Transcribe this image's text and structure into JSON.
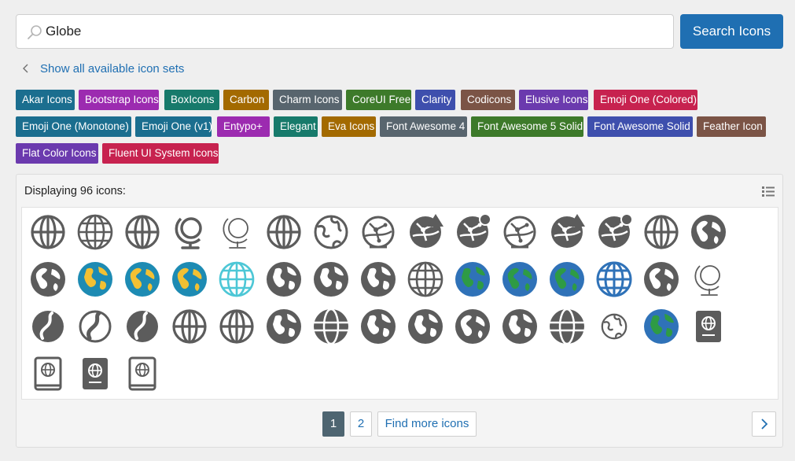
{
  "search": {
    "value": "Globe",
    "button_label": "Search Icons"
  },
  "back_link": {
    "label": "Show all available icon sets"
  },
  "tags": [
    {
      "label": "Akar Icons",
      "color": "#1b6e8f"
    },
    {
      "label": "Bootstrap Icons",
      "color": "#9c2bb0"
    },
    {
      "label": "BoxIcons",
      "color": "#177a6b"
    },
    {
      "label": "Carbon",
      "color": "#a36a00"
    },
    {
      "label": "Charm Icons",
      "color": "#58656e"
    },
    {
      "label": "CoreUI Free",
      "color": "#3d7a2a"
    },
    {
      "label": "Clarity",
      "color": "#3e4fad"
    },
    {
      "label": "Codicons",
      "color": "#7b5446"
    },
    {
      "label": "Elusive Icons",
      "color": "#6b3aae"
    },
    {
      "label": "Emoji One (Colored)",
      "color": "#c7224f"
    },
    {
      "label": "Emoji One (Monotone)",
      "color": "#1b6e8f"
    },
    {
      "label": "Emoji One (v1)",
      "color": "#1b6e8f"
    },
    {
      "label": "Entypo+",
      "color": "#9c2bb0"
    },
    {
      "label": "Elegant",
      "color": "#177a6b"
    },
    {
      "label": "Eva Icons",
      "color": "#a36a00"
    },
    {
      "label": "Font Awesome 4",
      "color": "#58656e"
    },
    {
      "label": "Font Awesome 5 Solid",
      "color": "#3d7a2a"
    },
    {
      "label": "Font Awesome Solid",
      "color": "#3e4fad"
    },
    {
      "label": "Feather Icon",
      "color": "#7b5446"
    },
    {
      "label": "Flat Color Icons",
      "color": "#6b3aae"
    },
    {
      "label": "Fluent UI System Icons",
      "color": "#c7224f"
    }
  ],
  "results": {
    "title": "Displaying 96 icons:"
  },
  "icons": [
    "globe-icon",
    "globe-grid-icon",
    "globe-icon",
    "desk-globe-icon",
    "desk-globe-outline-icon",
    "globe-icon",
    "earth-outline-icon",
    "globe-network-icon",
    "globe-network-warning-icon",
    "globe-network-dot-icon",
    "globe-network-icon",
    "globe-network-warning-icon",
    "globe-network-dot-icon",
    "globe-icon",
    "earth-africa-icon",
    "earth-africa-icon",
    "earth-americas-color-icon",
    "earth-asia-color-icon",
    "earth-africa-color-icon",
    "globe-cyan-icon",
    "earth-americas-icon",
    "earth-americas-icon",
    "earth-americas-icon",
    "globe-grid-icon",
    "earth-americas-blue-icon",
    "earth-asia-blue-icon",
    "earth-africa-blue-icon",
    "globe-meridian-blue-icon",
    "earth-africa-icon",
    "desk-globe-outline-icon",
    "earth-minimal-icon",
    "earth-outline-icon",
    "earth-minimal-icon",
    "globe-icon",
    "globe-icon",
    "earth-americas-icon",
    "globe-solid-icon",
    "earth-americas-icon",
    "earth-americas-icon",
    "earth-asia-icon",
    "earth-europe-icon",
    "globe-solid-icon",
    "earth-small-icon",
    "earth-color-icon",
    "passport-icon",
    "passport-outline-icon",
    "passport-icon",
    "passport-outline-icon"
  ],
  "pagination": {
    "pages": [
      "1",
      "2"
    ],
    "find_more_label": "Find more icons"
  },
  "colors": {
    "accent": "#1f6fb2",
    "icon": "#5c5c5c",
    "ocean": "#1d8bb3",
    "land_yellow": "#f2c033",
    "ocean_blue": "#2f72b8",
    "land_green": "#2e9b45",
    "cyan": "#4dc7d6"
  }
}
